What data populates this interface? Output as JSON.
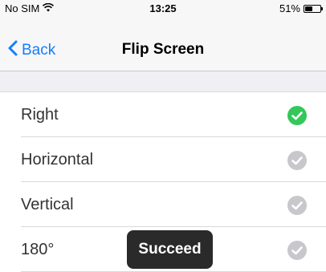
{
  "status_bar": {
    "carrier": "No SIM",
    "wifi_icon": "wifi-icon",
    "time": "13:25",
    "battery_percent": "51%",
    "battery_level": 0.51
  },
  "nav": {
    "back_label": "Back",
    "back_icon": "chevron-left-icon",
    "title": "Flip Screen",
    "accent_color": "#157efb"
  },
  "options": [
    {
      "label": "Right",
      "selected": true
    },
    {
      "label": "Horizontal",
      "selected": false
    },
    {
      "label": "Vertical",
      "selected": false
    },
    {
      "label": "180°",
      "selected": false
    }
  ],
  "check_colors": {
    "selected": "#34c759",
    "unselected": "#c7c7cc"
  },
  "toast": {
    "message": "Succeed"
  }
}
